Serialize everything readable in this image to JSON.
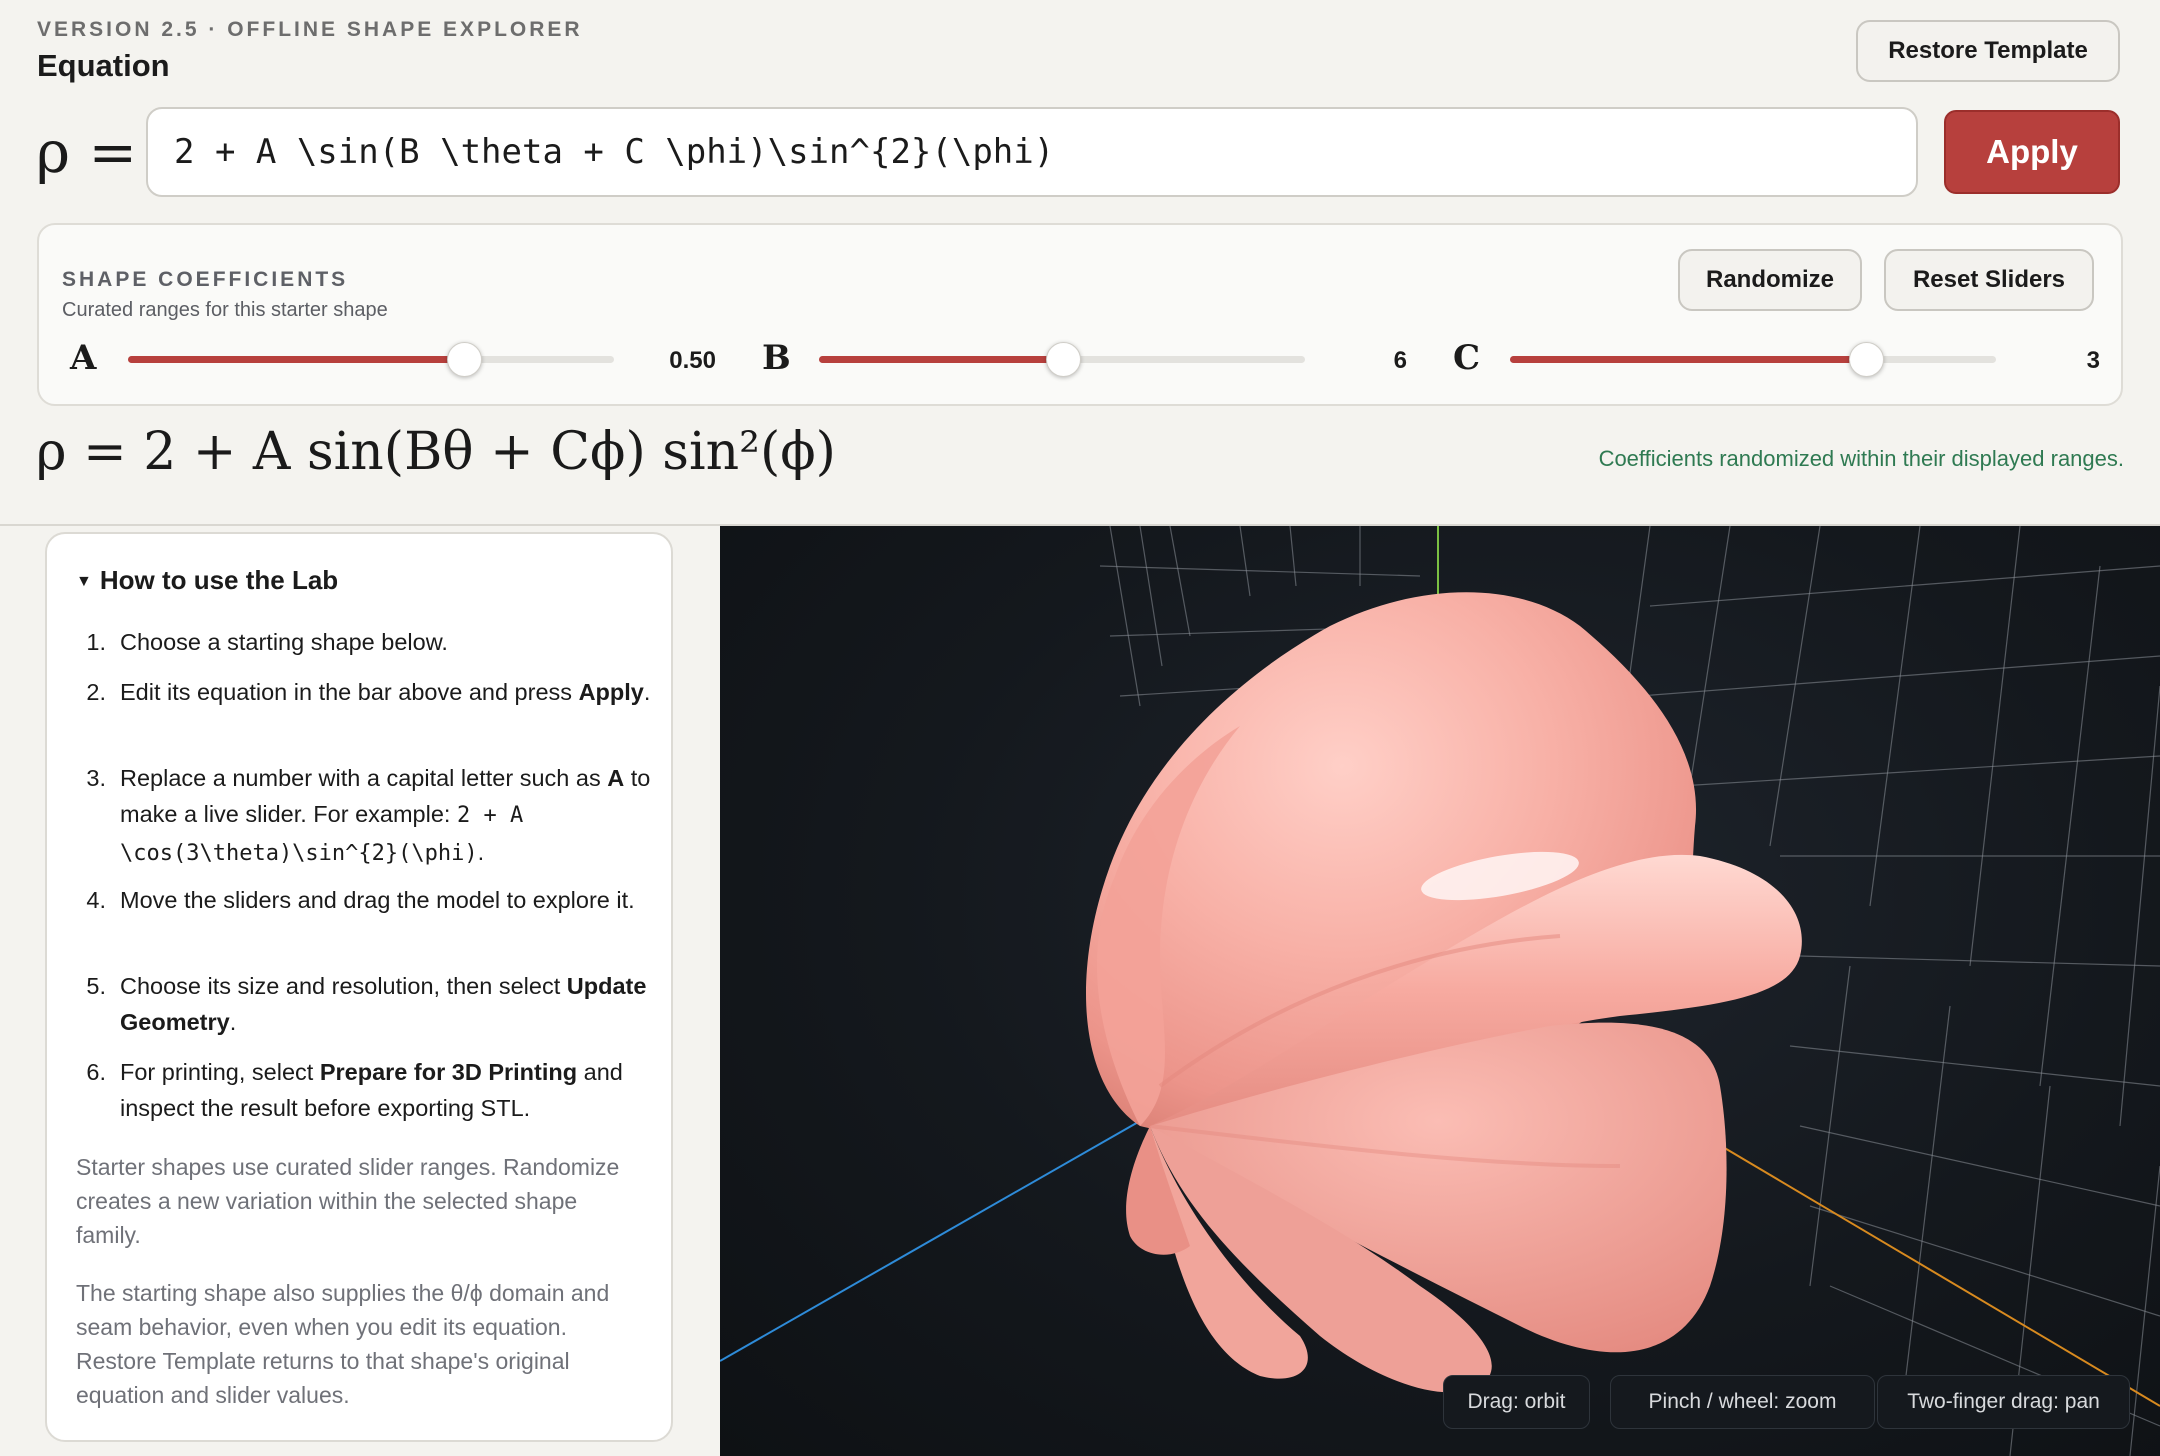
{
  "header": {
    "version": "VERSION 2.5 · OFFLINE SHAPE EXPLORER",
    "section_title": "Equation",
    "restore_label": "Restore Template",
    "rho_label": "ρ =",
    "equation_value": "2 + A \\sin(B \\theta + C \\phi)\\sin^{2}(\\phi)",
    "apply_label": "Apply"
  },
  "coefficients": {
    "title": "SHAPE COEFFICIENTS",
    "subtitle": "Curated ranges for this starter shape",
    "randomize_label": "Randomize",
    "reset_label": "Reset Sliders",
    "sliders": [
      {
        "letter": "A",
        "value_text": "0.50",
        "fraction": 0.69
      },
      {
        "letter": "B",
        "value_text": "6",
        "fraction": 0.5
      },
      {
        "letter": "C",
        "value_text": "3",
        "fraction": 0.73
      }
    ]
  },
  "formula": {
    "text": "ρ = 2 + A sin(Bθ + Cϕ) sin²(ϕ)"
  },
  "status_message": "Coefficients randomized within their displayed ranges.",
  "help": {
    "title": "How to use the Lab",
    "steps": [
      {
        "num": "1.",
        "text": "Choose a starting shape below."
      },
      {
        "num": "2.",
        "pre": "Edit its equation in the bar above and press ",
        "bold": "Apply",
        "post": "."
      },
      {
        "num": "3.",
        "pre": "Replace a number with a capital letter such as ",
        "bold": "A",
        "mid": " to make a live slider. For example: ",
        "code": "2 + A \\cos(3\\theta)\\sin^{2}(\\phi)",
        "post": "."
      },
      {
        "num": "4.",
        "text": "Move the sliders and drag the model to explore it."
      },
      {
        "num": "5.",
        "pre": "Choose its size and resolution, then select ",
        "bold": "Update Geometry",
        "post": "."
      },
      {
        "num": "6.",
        "pre": "For printing, select ",
        "bold": "Prepare for 3D Printing",
        "post": " and inspect the result before exporting STL."
      }
    ],
    "note1": "Starter shapes use curated slider ranges. Randomize creates a new variation within the selected shape family.",
    "note2": "The starting shape also supplies the θ/ϕ domain and seam behavior, even when you edit its equation. Restore Template returns to that shape's original equation and slider values."
  },
  "viewport": {
    "hints": [
      "Drag: orbit",
      "Pinch / wheel: zoom",
      "Two-finger drag: pan"
    ],
    "shape_color": "#f6aca2",
    "background_color": "#14181d"
  },
  "colors": {
    "accent": "#b7403d",
    "status": "#2f7a52"
  }
}
